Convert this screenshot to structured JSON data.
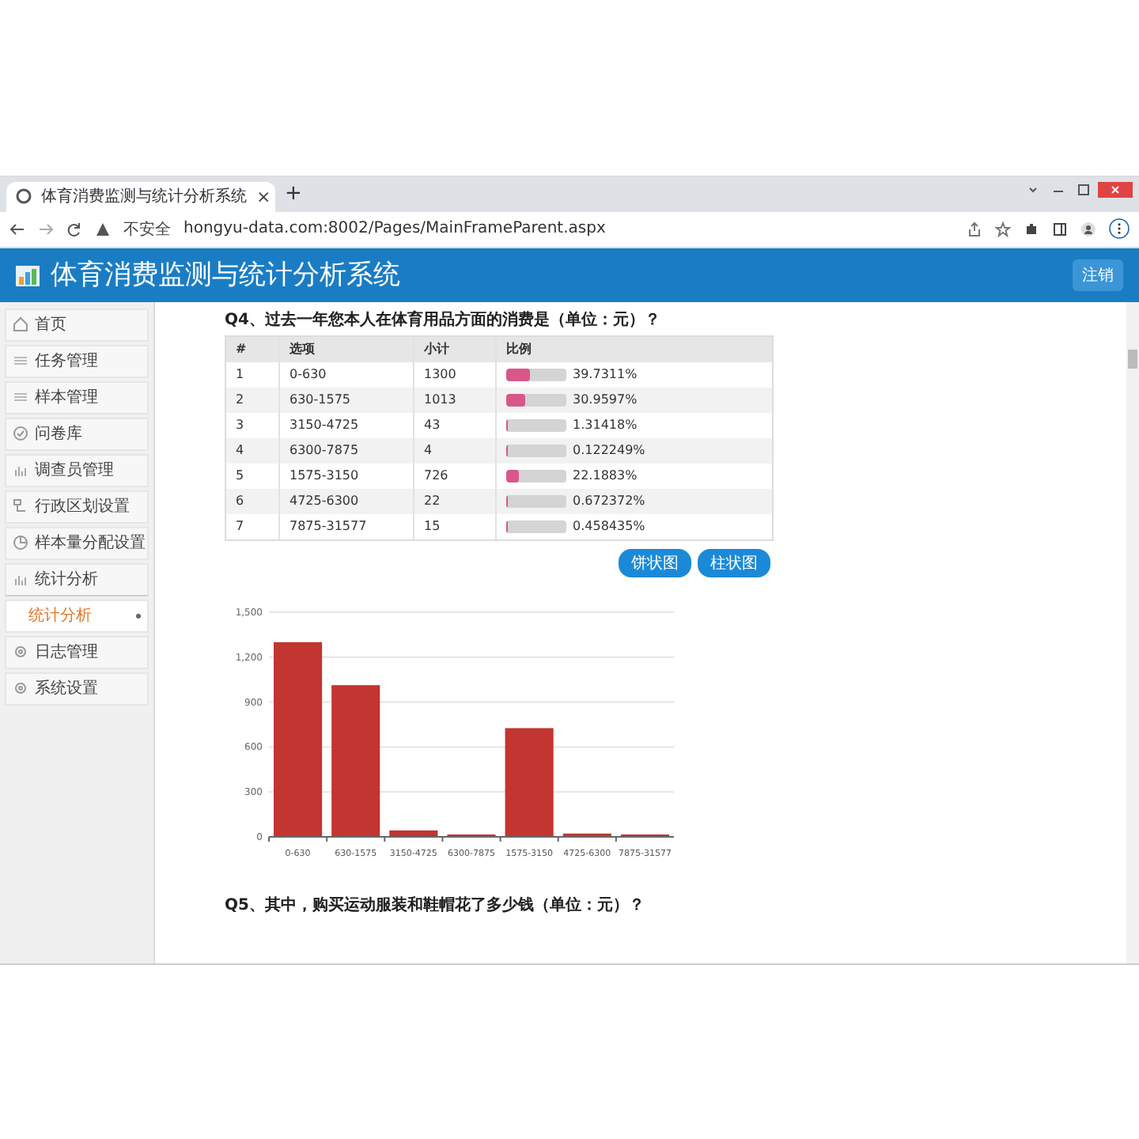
{
  "browser": {
    "tab_title": "体育消费监测与统计分析系统",
    "close_tab": "×",
    "new_tab": "+",
    "security": "不安全",
    "url": "hongyu-data.com:8002/Pages/MainFrameParent.aspx"
  },
  "header": {
    "title": "体育消费监测与统计分析系统",
    "logout": "注销"
  },
  "sidebar": {
    "items": [
      {
        "label": "首页",
        "selected": false
      },
      {
        "label": "任务管理",
        "selected": false
      },
      {
        "label": "样本管理",
        "selected": false
      },
      {
        "label": "问卷库",
        "selected": false
      },
      {
        "label": "调查员管理",
        "selected": false
      },
      {
        "label": "行政区划设置",
        "selected": false
      },
      {
        "label": "样本量分配设置",
        "selected": false
      },
      {
        "label": "统计分析",
        "selected": false,
        "expanded": true,
        "children": [
          {
            "label": "统计分析",
            "selected": true
          }
        ]
      },
      {
        "label": "日志管理",
        "selected": false
      },
      {
        "label": "系统设置",
        "selected": false
      }
    ]
  },
  "question": {
    "title": "Q4、过去一年您本人在体育用品方面的消费是（单位：元）？",
    "table": {
      "columns": [
        "#",
        "选项",
        "小计",
        "比例"
      ],
      "rows": [
        {
          "index": "1",
          "option": "0-630",
          "count": "1300",
          "level": 0.397311,
          "percent": "39.7311%"
        },
        {
          "index": "2",
          "option": "630-1575",
          "count": "1013",
          "level": 0.305597,
          "percent": "30.9597%"
        },
        {
          "index": "3",
          "option": "3150-4725",
          "count": "43",
          "level": 0.0131418,
          "percent": "1.31418%"
        },
        {
          "index": "4",
          "option": "6300-7875",
          "count": "4",
          "level": 0.00122249,
          "percent": "0.122249%"
        },
        {
          "index": "5",
          "option": "1575-3150",
          "count": "726",
          "level": 0.221883,
          "percent": "22.1883%"
        },
        {
          "index": "6",
          "option": "4725-6300",
          "count": "22",
          "level": 0.00672372,
          "percent": "0.672372%"
        },
        {
          "index": "7",
          "option": "7875-31577",
          "count": "15",
          "level": 0.00458435,
          "percent": "0.458435%"
        }
      ]
    },
    "buttons": [
      "饼状图",
      "柱状图"
    ],
    "chart_data": {
      "type": "bar",
      "categories": [
        "0-630",
        "630-1575",
        "3150-4725",
        "6300-7875",
        "1575-3150",
        "4725-6300",
        "7875-31577"
      ],
      "values": [
        1300,
        1013,
        43,
        4,
        726,
        22,
        15
      ],
      "grid": true,
      "ylim": [
        0,
        1500
      ],
      "yticks": [
        0,
        300,
        600,
        900,
        {
          "value": 1200,
          "label": "1,200"
        },
        {
          "value": 1500,
          "label": "1,500"
        }
      ]
    }
  },
  "next_question": {
    "title": "Q5、其中，购买运动服装和鞋帽花了多少钱（单位：元）？"
  }
}
